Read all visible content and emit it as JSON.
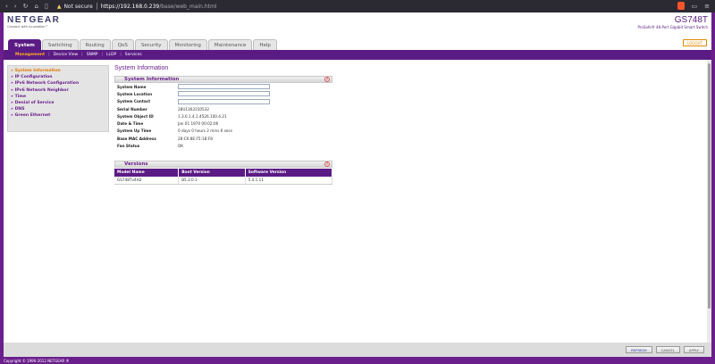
{
  "browser": {
    "nav_icons": [
      "chevron-left-icon",
      "chevron-right-icon",
      "reload-icon",
      "home-icon",
      "bookmark-icon"
    ],
    "security_label": "Not secure",
    "url_host": "https://192.168.0.239",
    "url_path": "/base/web_main.html"
  },
  "header": {
    "brand": "NETGEAR",
    "tagline": "Connect with Innovation™",
    "model": "GS748T",
    "model_desc": "ProSafe® 48-Port Gigabit Smart Switch",
    "logout": "LOGOUT"
  },
  "tabs": [
    {
      "label": "System",
      "active": true
    },
    {
      "label": "Switching"
    },
    {
      "label": "Routing"
    },
    {
      "label": "QoS"
    },
    {
      "label": "Security"
    },
    {
      "label": "Monitoring"
    },
    {
      "label": "Maintenance"
    },
    {
      "label": "Help"
    }
  ],
  "subnav": [
    "Management",
    "Device View",
    "SNMP",
    "LLDP",
    "Services"
  ],
  "sidebar": {
    "items": [
      {
        "label": "» System Information",
        "active": true
      },
      {
        "label": "» IP Configuration"
      },
      {
        "label": "» IPv6 Network Configuration"
      },
      {
        "label": "» IPv6 Network Neighbor"
      },
      {
        "label": "» Time"
      },
      {
        "label": "» Denial of Service"
      },
      {
        "label": "» DNS"
      },
      {
        "label": "» Green Ethernet"
      }
    ]
  },
  "main": {
    "page_title": "System Information",
    "sysinfo": {
      "title": "System Information",
      "name": {
        "label": "System Name",
        "value": ""
      },
      "location": {
        "label": "System Location",
        "value": ""
      },
      "contact": {
        "label": "System Contact",
        "value": ""
      },
      "serial": {
        "label": "Serial Number",
        "value": "28U1363150532"
      },
      "oid": {
        "label": "System Object ID",
        "value": "1.3.6.1.4.1.4526.100.4.21"
      },
      "datetime": {
        "label": "Date & Time",
        "value": "Jan 01 1970 00:02:06"
      },
      "uptime": {
        "label": "System Up Time",
        "value": "0 days 0 hours 2 mins 6 secs"
      },
      "mac": {
        "label": "Base MAC Address",
        "value": "28:C6:8E:F5:1B:F8"
      },
      "fan": {
        "label": "Fan Status",
        "value": "OK"
      }
    },
    "versions": {
      "title": "Versions",
      "headers": {
        "model": "Model Name",
        "boot": "Boot Version",
        "software": "Software Version"
      },
      "row": {
        "model": "GS748Tv4H2",
        "boot": "B5.3.0.1",
        "software": "5.4.1.11"
      }
    }
  },
  "footer": {
    "refresh": "REFRESH",
    "cancel": "CANCEL",
    "apply": "APPLY"
  },
  "copyright": "Copyright © 1996-2012 NETGEAR ®"
}
